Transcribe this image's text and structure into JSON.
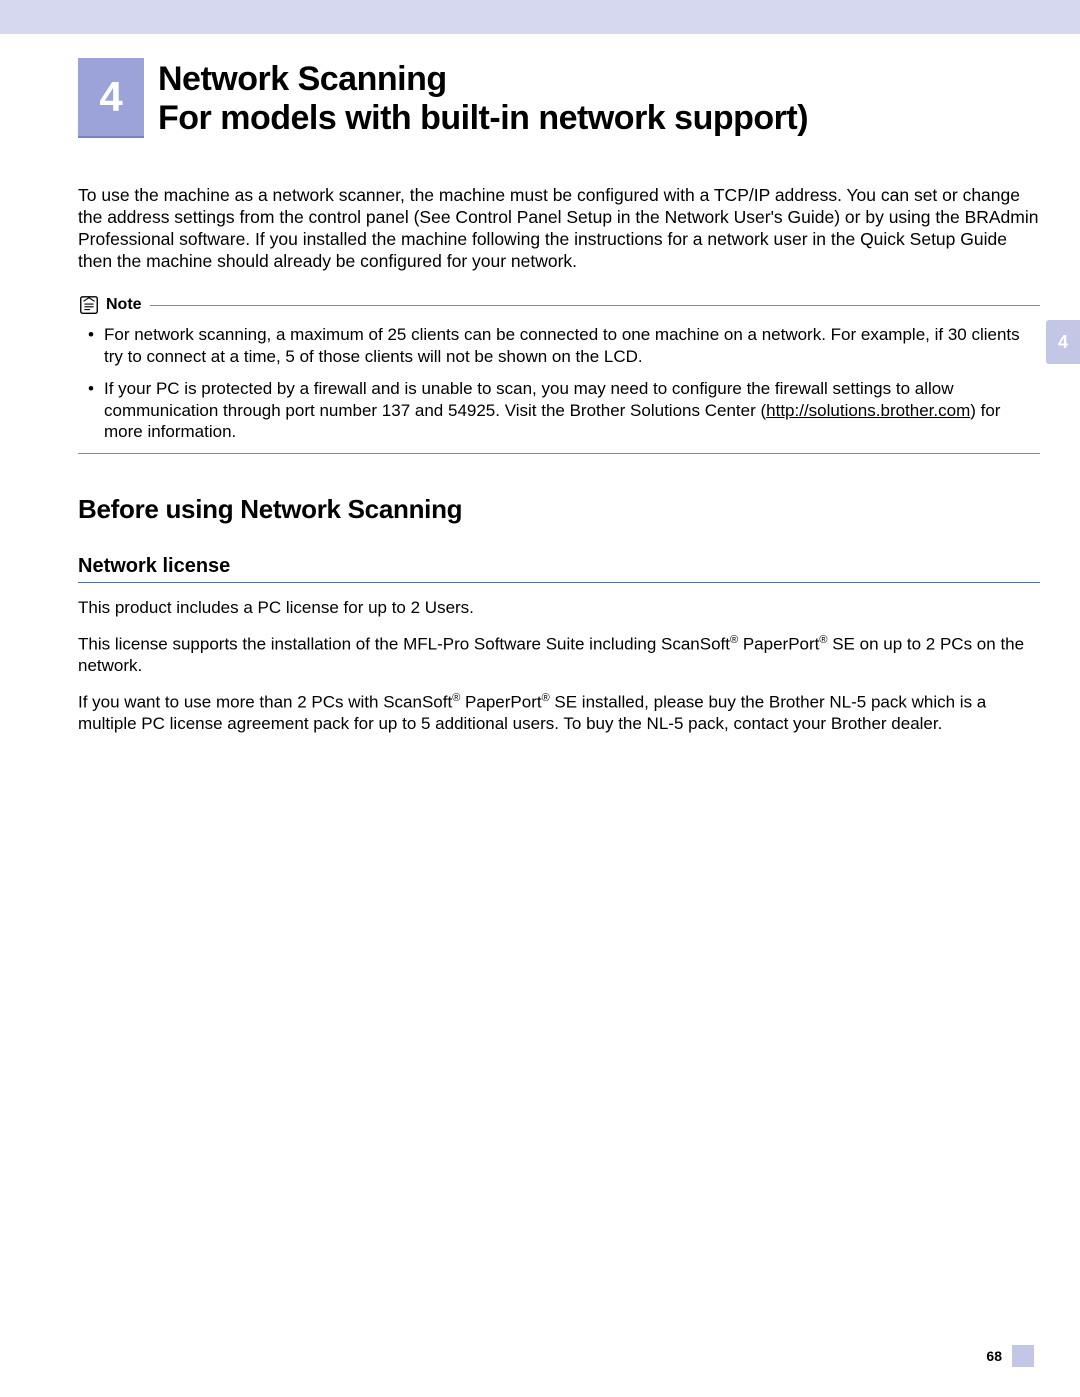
{
  "chapter": {
    "number": "4",
    "title_line1": "Network Scanning",
    "title_line2": "For models with built-in network support)"
  },
  "intro_paragraph": "To use the machine as a network scanner, the machine must be configured with a TCP/IP address. You can set or change the address settings from the control panel (See Control Panel Setup in the Network User's Guide) or by using the BRAdmin Professional software. If you installed the machine following the instructions for a network user in the Quick Setup Guide then the machine should already be configured for your network.",
  "note": {
    "label": "Note",
    "items": [
      {
        "text": "For network scanning, a maximum of 25 clients can be connected to one machine on a network. For example, if 30 clients try to connect at a time, 5 of those clients will not be shown on the LCD."
      },
      {
        "prefix": "If your PC is protected by a firewall and is unable to scan, you may need to configure the firewall settings to allow communication through port number 137 and 54925. Visit the Brother Solutions Center (",
        "link_text": "http://solutions.brother.com",
        "suffix": ") for more information."
      }
    ]
  },
  "section": {
    "heading": "Before using Network Scanning",
    "subsection_heading": "Network license",
    "p1": "This product includes a PC license for up to 2 Users.",
    "p2_a": "This license supports the installation of the MFL-Pro Software Suite including ScanSoft",
    "p2_b": " PaperPort",
    "p2_c": " SE on up to 2 PCs on the network.",
    "p3_a": "If you want to use more than 2 PCs with ScanSoft",
    "p3_b": " PaperPort",
    "p3_c": " SE installed, please buy the Brother NL-5 pack which is a multiple PC license agreement pack for up to 5 additional users. To buy the NL-5 pack, contact your Brother dealer."
  },
  "side_tab": "4",
  "page_number": "68"
}
